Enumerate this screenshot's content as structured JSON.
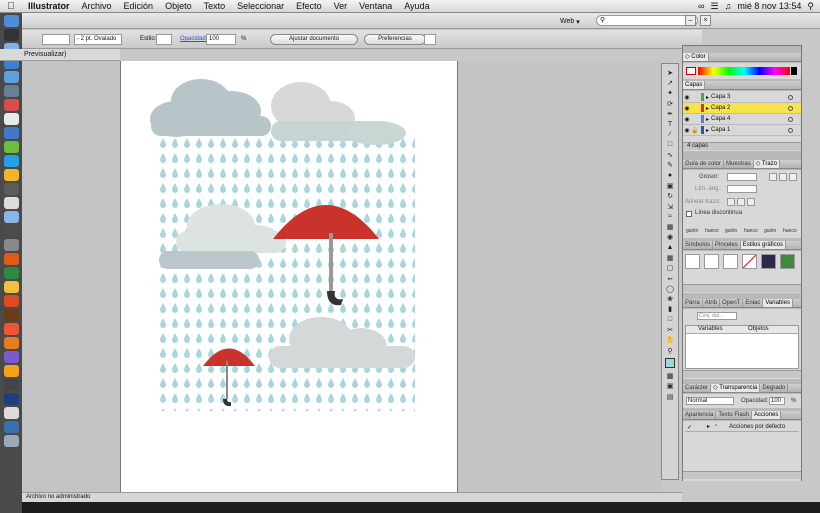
{
  "menubar": {
    "apple": "",
    "items": [
      "Illustrator",
      "Archivo",
      "Edición",
      "Objeto",
      "Texto",
      "Seleccionar",
      "Efecto",
      "Ver",
      "Ventana",
      "Ayuda"
    ],
    "clock": "mié 8 nov  13:54"
  },
  "titlebar": {
    "workspace": "Web",
    "search_placeholder": ""
  },
  "control": {
    "stroke_label": "2 pt. Ovalado",
    "style_label": "Estilo:",
    "opacity_label": "Opacidad:",
    "opacity_value": "100",
    "percent": "%",
    "adjust_button": "Ajustar documento",
    "prefs_button": "Preferencias"
  },
  "doc_tab": "Previsualizar)",
  "status": "Archivo no administrado",
  "panels": {
    "color_tab": "Color",
    "layers_tab": "Capas",
    "layers": [
      {
        "name": "Capa 3",
        "color": "#4aa84a"
      },
      {
        "name": "Capa 2",
        "color": "#e23030"
      },
      {
        "name": "Capa 4",
        "color": "#5a7ad8"
      },
      {
        "name": "Capa 1",
        "color": "#2b4fc4"
      }
    ],
    "layers_count": "4 capas",
    "stroke_tabs": [
      "Guía de color",
      "Muestras",
      "Trazo"
    ],
    "stroke": {
      "weight_label": "Grosor:",
      "miter_label": "Lím. áng.:",
      "align_label": "Alinear trazo:",
      "dashed_label": "Línea discontinua",
      "dash_labels": [
        "guión",
        "hueco",
        "guión",
        "hueco",
        "guión",
        "hueco"
      ]
    },
    "symbols_tabs": [
      "Símbolos",
      "Pinceles",
      "Estilos gráficos"
    ],
    "variables_tabs": [
      "Párra",
      "Atrib",
      "OpenT",
      "Enlac",
      "Variables"
    ],
    "variables": {
      "dataset_placeholder": "Conj. dat...",
      "col_variables": "Variables",
      "col_objects": "Objetos"
    },
    "transp_tabs": [
      "Carácter",
      "Transparencia",
      "Degrado"
    ],
    "transp": {
      "mode": "Normal",
      "opacity_label": "Opacidad:",
      "opacity_value": "100",
      "percent": "%"
    },
    "actions_tabs": [
      "Apariencia",
      "Texto Flash",
      "Acciones"
    ],
    "actions": {
      "set_name": "Acciones por defecto"
    }
  }
}
